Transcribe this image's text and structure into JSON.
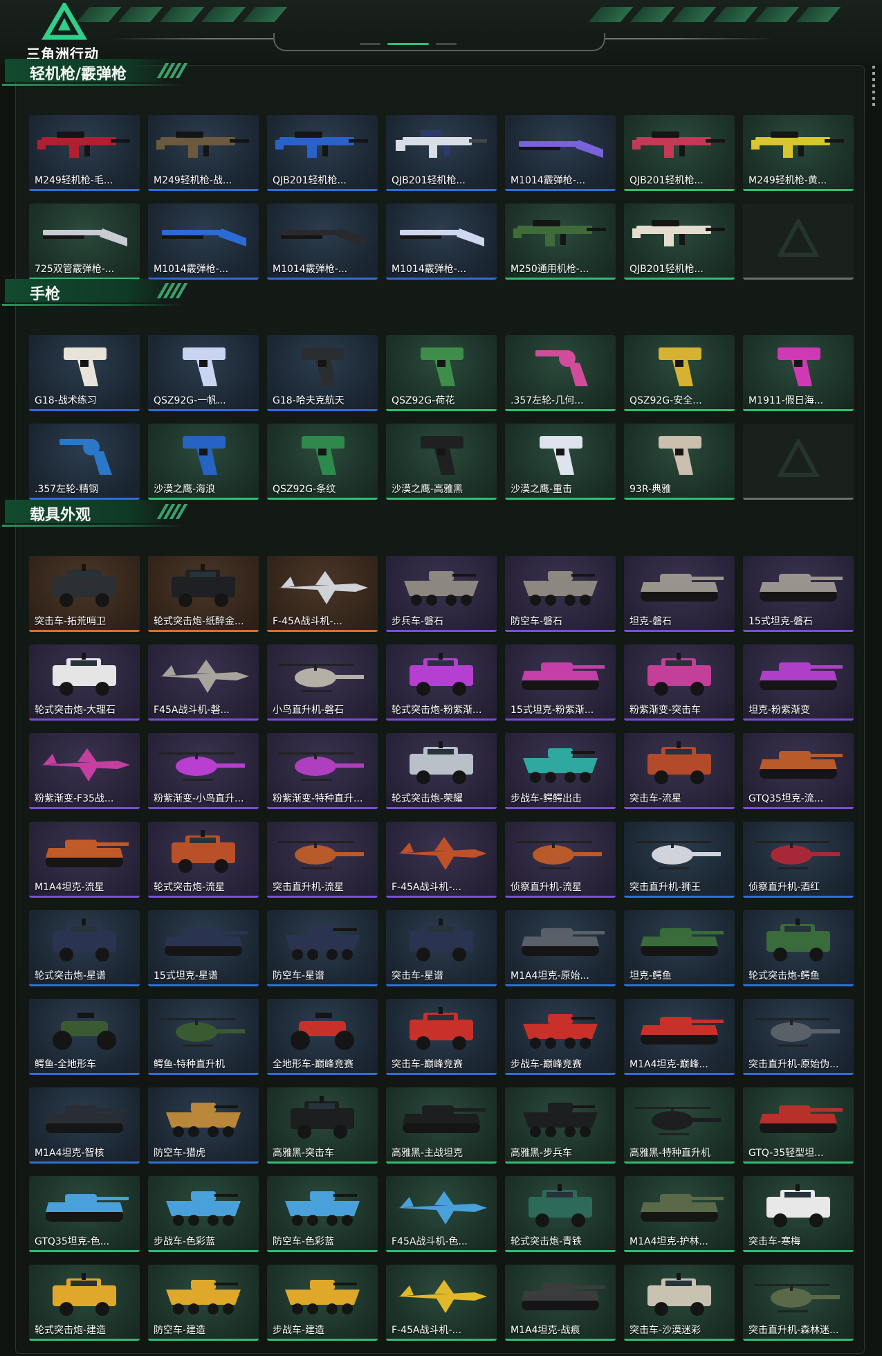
{
  "app": {
    "logo_text": "三角洲行动"
  },
  "colors": {
    "blue_strip": "#2f6fd6",
    "green_strip": "#2fbf71",
    "orange_strip": "#d9702a",
    "purple_strip": "#7a4fd8",
    "gold_strip": "#d4b33a"
  },
  "sections": [
    {
      "title": "轻机枪/霰弹枪",
      "items": [
        {
          "label": "M249轻机枪-毛...",
          "strip": "blue",
          "art": "lmg",
          "color": "#b02030",
          "bg": "blue"
        },
        {
          "label": "M249轻机枪-战...",
          "strip": "blue",
          "art": "lmg",
          "color": "#6b5a3e",
          "bg": "blue"
        },
        {
          "label": "QJB201轻机枪...",
          "strip": "blue",
          "art": "lmg",
          "color": "#2b62c9",
          "bg": "blue"
        },
        {
          "label": "QJB201轻机枪...",
          "strip": "blue",
          "art": "rifle",
          "color": "#d8dde6",
          "bg": "blue"
        },
        {
          "label": "M1014霰弹枪-...",
          "strip": "blue",
          "art": "shotgun",
          "color": "#7a63d8",
          "bg": "blue"
        },
        {
          "label": "QJB201轻机枪...",
          "strip": "green",
          "art": "lmg",
          "color": "#c23a55",
          "bg": "green"
        },
        {
          "label": "M249轻机枪-黄...",
          "strip": "green",
          "art": "lmg",
          "color": "#d8c530",
          "bg": "green"
        },
        {
          "label": "725双管霰弹枪-...",
          "strip": "green",
          "art": "shotgun",
          "color": "#c9ccd2",
          "bg": "green"
        },
        {
          "label": "M1014霰弹枪-...",
          "strip": "blue",
          "art": "shotgun",
          "color": "#2b6bd6",
          "bg": "blue"
        },
        {
          "label": "M1014霰弹枪-...",
          "strip": "blue",
          "art": "shotgun",
          "color": "#2a2a2e",
          "bg": "blue"
        },
        {
          "label": "M1014霰弹枪-...",
          "strip": "blue",
          "art": "shotgun",
          "color": "#d0d6f0",
          "bg": "blue"
        },
        {
          "label": "M250通用机枪-...",
          "strip": "green",
          "art": "lmg",
          "color": "#3f6b3a",
          "bg": "green"
        },
        {
          "label": "QJB201轻机枪...",
          "strip": "green",
          "art": "lmg",
          "color": "#e3ddcf",
          "bg": "green"
        },
        {
          "label": "",
          "strip": "gray",
          "art": "empty",
          "color": "",
          "bg": "empty"
        }
      ]
    },
    {
      "title": "手枪",
      "items": [
        {
          "label": "G18-战术练习",
          "strip": "blue",
          "art": "pistol",
          "color": "#e8e3d8",
          "bg": "blue"
        },
        {
          "label": "QSZ92G-一帆...",
          "strip": "blue",
          "art": "pistol",
          "color": "#c9d4f0",
          "bg": "blue"
        },
        {
          "label": "G18-哈夫克航天",
          "strip": "blue",
          "art": "pistol",
          "color": "#2a2e30",
          "bg": "blue"
        },
        {
          "label": "QSZ92G-荷花",
          "strip": "green",
          "art": "pistol",
          "color": "#3e8d4a",
          "bg": "green"
        },
        {
          "label": ".357左轮-几何...",
          "strip": "green",
          "art": "revolver",
          "color": "#d14d9b",
          "bg": "green"
        },
        {
          "label": "QSZ92G-安全...",
          "strip": "green",
          "art": "pistol",
          "color": "#d6b233",
          "bg": "green"
        },
        {
          "label": "M1911-假日海...",
          "strip": "green",
          "art": "pistol",
          "color": "#d039b4",
          "bg": "green"
        },
        {
          "label": ".357左轮-精钢",
          "strip": "blue",
          "art": "revolver",
          "color": "#2b77c9",
          "bg": "blue"
        },
        {
          "label": "沙漠之鹰-海浪",
          "strip": "green",
          "art": "pistol",
          "color": "#2763c2",
          "bg": "green"
        },
        {
          "label": "QSZ92G-条纹",
          "strip": "green",
          "art": "pistol",
          "color": "#2e8a4c",
          "bg": "green"
        },
        {
          "label": "沙漠之鹰-高雅黑",
          "strip": "green",
          "art": "pistol",
          "color": "#1f2022",
          "bg": "green"
        },
        {
          "label": "沙漠之鹰-重击",
          "strip": "green",
          "art": "pistol",
          "color": "#dfe3ee",
          "bg": "green"
        },
        {
          "label": "93R-典雅",
          "strip": "green",
          "art": "pistol",
          "color": "#cdbfae",
          "bg": "green"
        },
        {
          "label": "",
          "strip": "gray",
          "art": "empty",
          "color": "",
          "bg": "empty"
        }
      ]
    },
    {
      "title": "载具外观",
      "items": [
        {
          "label": "突击车-拓荒哨卫",
          "strip": "orange",
          "art": "truck",
          "color": "#2c2f33",
          "bg": "brown"
        },
        {
          "label": "轮式突击炮-纸醉金...",
          "strip": "orange",
          "art": "truck",
          "color": "#1e2024",
          "bg": "brown"
        },
        {
          "label": "F-45A战斗机-...",
          "strip": "orange",
          "art": "jet",
          "color": "#cfd2d6",
          "bg": "brown"
        },
        {
          "label": "步兵车-磐石",
          "strip": "purple",
          "art": "apc",
          "color": "#8c8880",
          "bg": "purple"
        },
        {
          "label": "防空车-磐石",
          "strip": "purple",
          "art": "apc",
          "color": "#8c8880",
          "bg": "purple"
        },
        {
          "label": "坦克-磐石",
          "strip": "purple",
          "art": "tank",
          "color": "#9a958c",
          "bg": "purple"
        },
        {
          "label": "15式坦克-磐石",
          "strip": "purple",
          "art": "tank",
          "color": "#9a958c",
          "bg": "purple"
        },
        {
          "label": "轮式突击炮-大理石",
          "strip": "purple",
          "art": "truck",
          "color": "#e5e5e5",
          "bg": "purple"
        },
        {
          "label": "F45A战斗机-磐...",
          "strip": "purple",
          "art": "jet",
          "color": "#a8a49c",
          "bg": "purple"
        },
        {
          "label": "小鸟直升机-磐石",
          "strip": "purple",
          "art": "heli",
          "color": "#b4b0a6",
          "bg": "purple"
        },
        {
          "label": "轮式突击炮-粉紫渐...",
          "strip": "purple",
          "art": "truck",
          "color": "#b43fd0",
          "bg": "purple"
        },
        {
          "label": "15式坦克-粉紫渐...",
          "strip": "purple",
          "art": "tank",
          "color": "#c43fa8",
          "bg": "purple"
        },
        {
          "label": "粉紫渐变-突击车",
          "strip": "purple",
          "art": "truck",
          "color": "#c43f98",
          "bg": "purple"
        },
        {
          "label": "坦克-粉紫渐变",
          "strip": "purple",
          "art": "tank",
          "color": "#b03fc8",
          "bg": "purple"
        },
        {
          "label": "粉紫渐变-F35战...",
          "strip": "purple",
          "art": "jet",
          "color": "#c43fa0",
          "bg": "purple"
        },
        {
          "label": "粉紫渐变-小鸟直升...",
          "strip": "purple",
          "art": "heli",
          "color": "#b83fd0",
          "bg": "purple"
        },
        {
          "label": "粉紫渐变-特种直升...",
          "strip": "purple",
          "art": "heli",
          "color": "#b03fc0",
          "bg": "purple"
        },
        {
          "label": "轮式突击炮-荣耀",
          "strip": "purple",
          "art": "truck",
          "color": "#b8c0c8",
          "bg": "purple"
        },
        {
          "label": "步战车-鳄鳄出击",
          "strip": "purple",
          "art": "apc",
          "color": "#2fa8a0",
          "bg": "purple"
        },
        {
          "label": "突击车-流星",
          "strip": "purple",
          "art": "truck",
          "color": "#b34b2a",
          "bg": "purple"
        },
        {
          "label": "GTQ35坦克-流...",
          "strip": "purple",
          "art": "tank",
          "color": "#b85a2a",
          "bg": "purple"
        },
        {
          "label": "M1A4坦克-流星",
          "strip": "purple",
          "art": "tank",
          "color": "#c05a28",
          "bg": "purple"
        },
        {
          "label": "轮式突击炮-流星",
          "strip": "purple",
          "art": "truck",
          "color": "#b95028",
          "bg": "purple"
        },
        {
          "label": "突击直升机-流星",
          "strip": "purple",
          "art": "heli",
          "color": "#b85a2a",
          "bg": "purple"
        },
        {
          "label": "F-45A战斗机-...",
          "strip": "purple",
          "art": "jet",
          "color": "#c05028",
          "bg": "purple"
        },
        {
          "label": "侦察直升机-流星",
          "strip": "purple",
          "art": "heli",
          "color": "#b85a2a",
          "bg": "purple"
        },
        {
          "label": "突击直升机-狮王",
          "strip": "blue",
          "art": "heli",
          "color": "#d0d4da",
          "bg": "blue"
        },
        {
          "label": "侦察直升机-酒红",
          "strip": "blue",
          "art": "heli",
          "color": "#a82838",
          "bg": "blue"
        },
        {
          "label": "轮式突击炮-星谱",
          "strip": "blue",
          "art": "truck",
          "color": "#2a3350",
          "bg": "blue"
        },
        {
          "label": "15式坦克-星谱",
          "strip": "blue",
          "art": "tank",
          "color": "#2a3350",
          "bg": "blue"
        },
        {
          "label": "防空车-星谱",
          "strip": "blue",
          "art": "apc",
          "color": "#2a3350",
          "bg": "blue"
        },
        {
          "label": "突击车-星谱",
          "strip": "blue",
          "art": "truck",
          "color": "#2a3350",
          "bg": "blue"
        },
        {
          "label": "M1A4坦克-原始...",
          "strip": "blue",
          "art": "tank",
          "color": "#5a6068",
          "bg": "blue"
        },
        {
          "label": "坦克-鳄鱼",
          "strip": "blue",
          "art": "tank",
          "color": "#3a6b3a",
          "bg": "blue"
        },
        {
          "label": "轮式突击炮-鳄鱼",
          "strip": "blue",
          "art": "truck",
          "color": "#3a6b3a",
          "bg": "blue"
        },
        {
          "label": "鳄鱼-全地形车",
          "strip": "blue",
          "art": "atv",
          "color": "#3a5a32",
          "bg": "blue"
        },
        {
          "label": "鳄鱼-特种直升机",
          "strip": "blue",
          "art": "heli",
          "color": "#3a5a32",
          "bg": "blue"
        },
        {
          "label": "全地形车-巅峰竞赛",
          "strip": "blue",
          "art": "atv",
          "color": "#c8302a",
          "bg": "blue"
        },
        {
          "label": "突击车-巅峰竞赛",
          "strip": "blue",
          "art": "truck",
          "color": "#c8302a",
          "bg": "blue"
        },
        {
          "label": "步战车-巅峰竞赛",
          "strip": "blue",
          "art": "apc",
          "color": "#c8302a",
          "bg": "blue"
        },
        {
          "label": "M1A4坦克-巅峰...",
          "strip": "blue",
          "art": "tank",
          "color": "#c8302a",
          "bg": "blue"
        },
        {
          "label": "突击直升机-原始伪...",
          "strip": "blue",
          "art": "heli",
          "color": "#5a6068",
          "bg": "blue"
        },
        {
          "label": "M1A4坦克-智核",
          "strip": "blue",
          "art": "tank",
          "color": "#2a2e34",
          "bg": "blue"
        },
        {
          "label": "防空车-猎虎",
          "strip": "blue",
          "art": "apc",
          "color": "#b8873a",
          "bg": "blue"
        },
        {
          "label": "高雅黑-突击车",
          "strip": "green",
          "art": "truck",
          "color": "#1c1e20",
          "bg": "green"
        },
        {
          "label": "高雅黑-主战坦克",
          "strip": "green",
          "art": "tank",
          "color": "#1c1e20",
          "bg": "green"
        },
        {
          "label": "高雅黑-步兵车",
          "strip": "green",
          "art": "apc",
          "color": "#1c1e20",
          "bg": "green"
        },
        {
          "label": "高雅黑-特种直升机",
          "strip": "green",
          "art": "heli",
          "color": "#1c1e20",
          "bg": "green"
        },
        {
          "label": "GTQ-35轻型坦...",
          "strip": "green",
          "art": "tank",
          "color": "#b8302a",
          "bg": "green"
        },
        {
          "label": "GTQ35坦克-色...",
          "strip": "green",
          "art": "tank",
          "color": "#4aa0d8",
          "bg": "green"
        },
        {
          "label": "步战车-色彩蓝",
          "strip": "green",
          "art": "apc",
          "color": "#4aa0d8",
          "bg": "green"
        },
        {
          "label": "防空车-色彩蓝",
          "strip": "green",
          "art": "apc",
          "color": "#4aa0d8",
          "bg": "green"
        },
        {
          "label": "F45A战斗机-色...",
          "strip": "green",
          "art": "jet",
          "color": "#4aa0d8",
          "bg": "green"
        },
        {
          "label": "轮式突击炮-青铁",
          "strip": "green",
          "art": "truck",
          "color": "#2e6a5a",
          "bg": "green"
        },
        {
          "label": "M1A4坦克-护林...",
          "strip": "green",
          "art": "tank",
          "color": "#5a6a48",
          "bg": "green"
        },
        {
          "label": "突击车-寒梅",
          "strip": "green",
          "art": "truck",
          "color": "#e8e8e8",
          "bg": "green"
        },
        {
          "label": "轮式突击炮-建造",
          "strip": "green",
          "art": "truck",
          "color": "#e0a82a",
          "bg": "green"
        },
        {
          "label": "防空车-建造",
          "strip": "green",
          "art": "apc",
          "color": "#e0a82a",
          "bg": "green"
        },
        {
          "label": "步战车-建造",
          "strip": "green",
          "art": "apc",
          "color": "#e0a82a",
          "bg": "green"
        },
        {
          "label": "F-45A战斗机-...",
          "strip": "green",
          "art": "jet",
          "color": "#e0b82a",
          "bg": "green"
        },
        {
          "label": "M1A4坦克-战痕",
          "strip": "green",
          "art": "tank",
          "color": "#3a3c3e",
          "bg": "green"
        },
        {
          "label": "突击车-沙漠迷彩",
          "strip": "green",
          "art": "truck",
          "color": "#c8c2b0",
          "bg": "green"
        },
        {
          "label": "突击直升机-森林迷...",
          "strip": "green",
          "art": "heli",
          "color": "#5a6a48",
          "bg": "green"
        }
      ]
    }
  ]
}
